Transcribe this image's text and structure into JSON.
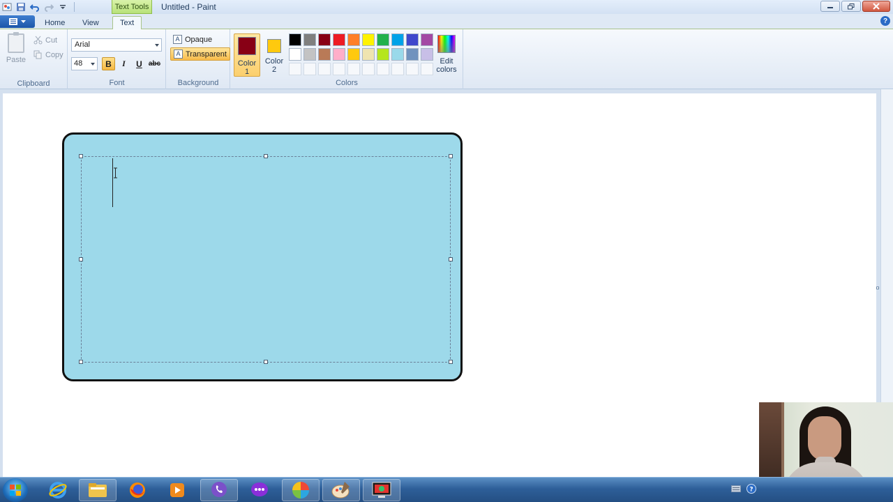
{
  "window": {
    "title": "Untitled - Paint",
    "context_tab": "Text Tools"
  },
  "tabs": [
    {
      "label": "Home"
    },
    {
      "label": "View"
    },
    {
      "label": "Text"
    }
  ],
  "clipboard": {
    "paste": "Paste",
    "cut": "Cut",
    "copy": "Copy",
    "group_label": "Clipboard"
  },
  "font": {
    "family": "Arial",
    "size": "48",
    "bold": "B",
    "italic": "I",
    "underline": "U",
    "strike": "abc",
    "group_label": "Font"
  },
  "background": {
    "opaque": "Opaque",
    "transparent": "Transparent",
    "selected": "transparent",
    "group_label": "Background"
  },
  "colors": {
    "color1_label": "Color\n1",
    "color2_label": "Color\n2",
    "color1": "#880015",
    "color2": "#ffc90e",
    "edit_label": "Edit\ncolors",
    "group_label": "Colors",
    "palette": [
      "#000000",
      "#7f7f7f",
      "#880015",
      "#ed1c24",
      "#ff7f27",
      "#fff200",
      "#22b14c",
      "#00a2e8",
      "#3f48cc",
      "#a349a4",
      "#ffffff",
      "#c3c3c3",
      "#b97a57",
      "#ffaec9",
      "#ffc90e",
      "#efe4b0",
      "#b5e61d",
      "#99d9ea",
      "#7092be",
      "#c8bfe7"
    ]
  },
  "canvas": {
    "card_fill": "#9dd9ea",
    "card_border": "#111111"
  }
}
